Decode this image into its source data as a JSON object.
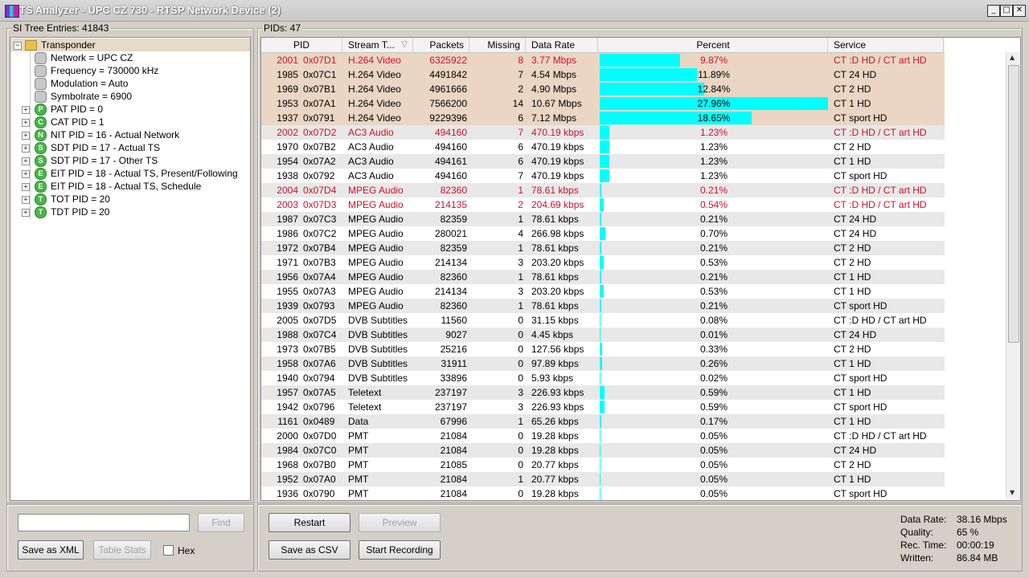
{
  "window": {
    "title": "TS Analyzer - UPC CZ 730 - RTSP Network Device (2)"
  },
  "si_tree": {
    "label": "SI Tree Entries: 41843",
    "nodes": [
      {
        "label": "Transponder",
        "icon": "folder-icon",
        "expander": "−",
        "level": 0,
        "selected": true
      },
      {
        "label": "Network = UPC CZ",
        "icon": "gray",
        "letter": "",
        "level": 1
      },
      {
        "label": "Frequency = 730000 kHz",
        "icon": "gray",
        "letter": "",
        "level": 1
      },
      {
        "label": "Modulation = Auto",
        "icon": "gray",
        "letter": "",
        "level": 1
      },
      {
        "label": "Symbolrate = 6900",
        "icon": "gray",
        "letter": "",
        "level": 1
      },
      {
        "label": "PAT PID = 0",
        "icon": "green",
        "letter": "P",
        "level": 1,
        "expander": "+"
      },
      {
        "label": "CAT PID = 1",
        "icon": "green",
        "letter": "C",
        "level": 1,
        "expander": "+"
      },
      {
        "label": "NIT PID = 16 - Actual Network",
        "icon": "green",
        "letter": "N",
        "level": 1,
        "expander": "+"
      },
      {
        "label": "SDT PID = 17 - Actual TS",
        "icon": "green",
        "letter": "S",
        "level": 1,
        "expander": "+"
      },
      {
        "label": "SDT PID = 17 - Other TS",
        "icon": "green",
        "letter": "S",
        "level": 1,
        "expander": "+"
      },
      {
        "label": "EIT PID = 18 - Actual TS, Present/Following",
        "icon": "green",
        "letter": "E",
        "level": 1,
        "expander": "+"
      },
      {
        "label": "EIT PID = 18 - Actual TS, Schedule",
        "icon": "green",
        "letter": "E",
        "level": 1,
        "expander": "+"
      },
      {
        "label": "TOT PID = 20",
        "icon": "green",
        "letter": "T",
        "level": 1,
        "expander": "+"
      },
      {
        "label": "TDT PID = 20",
        "icon": "green",
        "letter": "T",
        "level": 1,
        "expander": "+"
      }
    ],
    "search_value": "",
    "find_label": "Find",
    "save_xml_label": "Save as XML",
    "table_stats_label": "Table Stats",
    "hex_label": "Hex"
  },
  "pids": {
    "label": "PIDs: 47",
    "columns": [
      "PID",
      "Stream T...",
      "Packets",
      "Missing",
      "Data Rate",
      "Percent",
      "Service"
    ],
    "sort_indicator": "▽",
    "rows": [
      {
        "pid": "2001",
        "hex": "0x07D1",
        "type": "H.264 Video",
        "packets": "6325922",
        "missing": "8",
        "rate": "3.77 Mbps",
        "percent": "9.87%",
        "pct": 9.87,
        "service": "CT :D HD / CT art HD",
        "style": "hl",
        "red": true
      },
      {
        "pid": "1985",
        "hex": "0x07C1",
        "type": "H.264 Video",
        "packets": "4491842",
        "missing": "7",
        "rate": "4.54 Mbps",
        "percent": "11.89%",
        "pct": 11.89,
        "service": "CT 24 HD",
        "style": "hl",
        "red": false
      },
      {
        "pid": "1969",
        "hex": "0x07B1",
        "type": "H.264 Video",
        "packets": "4961666",
        "missing": "2",
        "rate": "4.90 Mbps",
        "percent": "12.84%",
        "pct": 12.84,
        "service": "CT 2 HD",
        "style": "hl",
        "red": false
      },
      {
        "pid": "1953",
        "hex": "0x07A1",
        "type": "H.264 Video",
        "packets": "7566200",
        "missing": "14",
        "rate": "10.67 Mbps",
        "percent": "27.96%",
        "pct": 27.96,
        "service": "CT 1 HD",
        "style": "hl",
        "red": false
      },
      {
        "pid": "1937",
        "hex": "0x0791",
        "type": "H.264 Video",
        "packets": "9229396",
        "missing": "6",
        "rate": "7.12 Mbps",
        "percent": "18.65%",
        "pct": 18.65,
        "service": "CT sport HD",
        "style": "hl",
        "red": false
      },
      {
        "pid": "2002",
        "hex": "0x07D2",
        "type": "AC3 Audio",
        "packets": "494160",
        "missing": "7",
        "rate": "470.19 kbps",
        "percent": "1.23%",
        "pct": 1.23,
        "service": "CT :D HD / CT art HD",
        "style": "alt",
        "red": true
      },
      {
        "pid": "1970",
        "hex": "0x07B2",
        "type": "AC3 Audio",
        "packets": "494160",
        "missing": "6",
        "rate": "470.19 kbps",
        "percent": "1.23%",
        "pct": 1.23,
        "service": "CT 2 HD",
        "style": "",
        "red": false
      },
      {
        "pid": "1954",
        "hex": "0x07A2",
        "type": "AC3 Audio",
        "packets": "494161",
        "missing": "6",
        "rate": "470.19 kbps",
        "percent": "1.23%",
        "pct": 1.23,
        "service": "CT 1 HD",
        "style": "alt",
        "red": false
      },
      {
        "pid": "1938",
        "hex": "0x0792",
        "type": "AC3 Audio",
        "packets": "494160",
        "missing": "7",
        "rate": "470.19 kbps",
        "percent": "1.23%",
        "pct": 1.23,
        "service": "CT sport HD",
        "style": "",
        "red": false
      },
      {
        "pid": "2004",
        "hex": "0x07D4",
        "type": "MPEG Audio",
        "packets": "82360",
        "missing": "1",
        "rate": "78.61 kbps",
        "percent": "0.21%",
        "pct": 0.21,
        "service": "CT :D HD / CT art HD",
        "style": "alt",
        "red": true
      },
      {
        "pid": "2003",
        "hex": "0x07D3",
        "type": "MPEG Audio",
        "packets": "214135",
        "missing": "2",
        "rate": "204.69 kbps",
        "percent": "0.54%",
        "pct": 0.54,
        "service": "CT :D HD / CT art HD",
        "style": "",
        "red": true
      },
      {
        "pid": "1987",
        "hex": "0x07C3",
        "type": "MPEG Audio",
        "packets": "82359",
        "missing": "1",
        "rate": "78.61 kbps",
        "percent": "0.21%",
        "pct": 0.21,
        "service": "CT 24 HD",
        "style": "alt",
        "red": false
      },
      {
        "pid": "1986",
        "hex": "0x07C2",
        "type": "MPEG Audio",
        "packets": "280021",
        "missing": "4",
        "rate": "266.98 kbps",
        "percent": "0.70%",
        "pct": 0.7,
        "service": "CT 24 HD",
        "style": "",
        "red": false
      },
      {
        "pid": "1972",
        "hex": "0x07B4",
        "type": "MPEG Audio",
        "packets": "82359",
        "missing": "1",
        "rate": "78.61 kbps",
        "percent": "0.21%",
        "pct": 0.21,
        "service": "CT 2 HD",
        "style": "alt",
        "red": false
      },
      {
        "pid": "1971",
        "hex": "0x07B3",
        "type": "MPEG Audio",
        "packets": "214134",
        "missing": "3",
        "rate": "203.20 kbps",
        "percent": "0.53%",
        "pct": 0.53,
        "service": "CT 2 HD",
        "style": "",
        "red": false
      },
      {
        "pid": "1956",
        "hex": "0x07A4",
        "type": "MPEG Audio",
        "packets": "82360",
        "missing": "1",
        "rate": "78.61 kbps",
        "percent": "0.21%",
        "pct": 0.21,
        "service": "CT 1 HD",
        "style": "alt",
        "red": false
      },
      {
        "pid": "1955",
        "hex": "0x07A3",
        "type": "MPEG Audio",
        "packets": "214134",
        "missing": "3",
        "rate": "203.20 kbps",
        "percent": "0.53%",
        "pct": 0.53,
        "service": "CT 1 HD",
        "style": "",
        "red": false
      },
      {
        "pid": "1939",
        "hex": "0x0793",
        "type": "MPEG Audio",
        "packets": "82360",
        "missing": "1",
        "rate": "78.61 kbps",
        "percent": "0.21%",
        "pct": 0.21,
        "service": "CT sport HD",
        "style": "alt",
        "red": false
      },
      {
        "pid": "2005",
        "hex": "0x07D5",
        "type": "DVB Subtitles",
        "packets": "11560",
        "missing": "0",
        "rate": "31.15 kbps",
        "percent": "0.08%",
        "pct": 0.08,
        "service": "CT :D HD / CT art HD",
        "style": "",
        "red": false
      },
      {
        "pid": "1988",
        "hex": "0x07C4",
        "type": "DVB Subtitles",
        "packets": "9027",
        "missing": "0",
        "rate": "4.45 kbps",
        "percent": "0.01%",
        "pct": 0.01,
        "service": "CT 24 HD",
        "style": "alt",
        "red": false
      },
      {
        "pid": "1973",
        "hex": "0x07B5",
        "type": "DVB Subtitles",
        "packets": "25216",
        "missing": "0",
        "rate": "127.56 kbps",
        "percent": "0.33%",
        "pct": 0.33,
        "service": "CT 2 HD",
        "style": "",
        "red": false
      },
      {
        "pid": "1958",
        "hex": "0x07A6",
        "type": "DVB Subtitles",
        "packets": "31911",
        "missing": "0",
        "rate": "97.89 kbps",
        "percent": "0.26%",
        "pct": 0.26,
        "service": "CT 1 HD",
        "style": "alt",
        "red": false
      },
      {
        "pid": "1940",
        "hex": "0x0794",
        "type": "DVB Subtitles",
        "packets": "33896",
        "missing": "0",
        "rate": "5.93 kbps",
        "percent": "0.02%",
        "pct": 0.02,
        "service": "CT sport HD",
        "style": "",
        "red": false
      },
      {
        "pid": "1957",
        "hex": "0x07A5",
        "type": "Teletext",
        "packets": "237197",
        "missing": "3",
        "rate": "226.93 kbps",
        "percent": "0.59%",
        "pct": 0.59,
        "service": "CT 1 HD",
        "style": "alt",
        "red": false
      },
      {
        "pid": "1942",
        "hex": "0x0796",
        "type": "Teletext",
        "packets": "237197",
        "missing": "3",
        "rate": "226.93 kbps",
        "percent": "0.59%",
        "pct": 0.59,
        "service": "CT sport HD",
        "style": "",
        "red": false
      },
      {
        "pid": "1161",
        "hex": "0x0489",
        "type": "Data",
        "packets": "67996",
        "missing": "1",
        "rate": "65.26 kbps",
        "percent": "0.17%",
        "pct": 0.17,
        "service": "CT 1 HD",
        "style": "alt",
        "red": false
      },
      {
        "pid": "2000",
        "hex": "0x07D0",
        "type": "PMT",
        "packets": "21084",
        "missing": "0",
        "rate": "19.28 kbps",
        "percent": "0.05%",
        "pct": 0.05,
        "service": "CT :D HD / CT art HD",
        "style": "",
        "red": false
      },
      {
        "pid": "1984",
        "hex": "0x07C0",
        "type": "PMT",
        "packets": "21084",
        "missing": "0",
        "rate": "19.28 kbps",
        "percent": "0.05%",
        "pct": 0.05,
        "service": "CT 24 HD",
        "style": "alt",
        "red": false
      },
      {
        "pid": "1968",
        "hex": "0x07B0",
        "type": "PMT",
        "packets": "21085",
        "missing": "0",
        "rate": "20.77 kbps",
        "percent": "0.05%",
        "pct": 0.05,
        "service": "CT 2 HD",
        "style": "",
        "red": false
      },
      {
        "pid": "1952",
        "hex": "0x07A0",
        "type": "PMT",
        "packets": "21084",
        "missing": "1",
        "rate": "20.77 kbps",
        "percent": "0.05%",
        "pct": 0.05,
        "service": "CT 1 HD",
        "style": "alt",
        "red": false
      },
      {
        "pid": "1936",
        "hex": "0x0790",
        "type": "PMT",
        "packets": "21084",
        "missing": "0",
        "rate": "19.28 kbps",
        "percent": "0.05%",
        "pct": 0.05,
        "service": "CT sport HD",
        "style": "",
        "red": false
      }
    ]
  },
  "controls": {
    "restart": "Restart",
    "preview": "Preview",
    "save_csv": "Save as CSV",
    "start_recording": "Start Recording"
  },
  "stats": [
    {
      "label": "Data Rate:",
      "value": "38.16 Mbps"
    },
    {
      "label": "Quality:",
      "value": "65 %"
    },
    {
      "label": "Rec. Time:",
      "value": "00:00:19"
    },
    {
      "label": "Written:",
      "value": "86.84 MB"
    }
  ],
  "colors": {
    "bar": "#00ffff",
    "highlight_row": "#ead6c3",
    "alt_row": "#e8e8e8",
    "error_text": "#d0102a"
  }
}
